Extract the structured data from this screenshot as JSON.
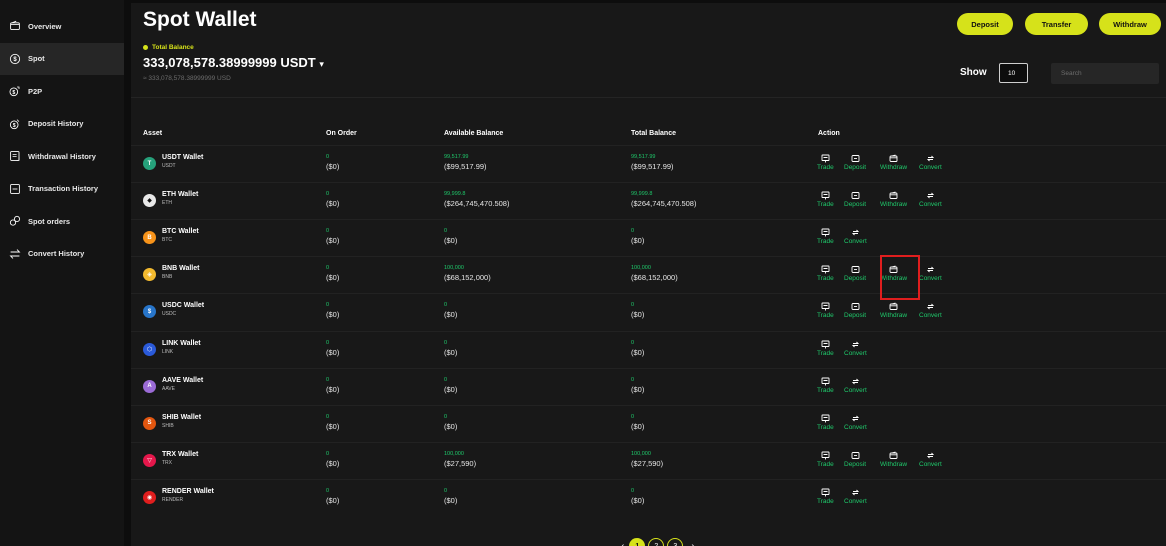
{
  "sidebar": {
    "items": [
      {
        "label": "Overview",
        "icon": "wallet-icon",
        "active": false
      },
      {
        "label": "Spot",
        "icon": "dollar-circle-icon",
        "active": true
      },
      {
        "label": "P2P",
        "icon": "p2p-icon",
        "active": false
      },
      {
        "label": "Deposit History",
        "icon": "deposit-history-icon",
        "active": false
      },
      {
        "label": "Withdrawal History",
        "icon": "withdrawal-history-icon",
        "active": false
      },
      {
        "label": "Transaction History",
        "icon": "transaction-history-icon",
        "active": false
      },
      {
        "label": "Spot orders",
        "icon": "spot-orders-icon",
        "active": false
      },
      {
        "label": "Convert History",
        "icon": "swap-arrows-icon",
        "active": false
      }
    ]
  },
  "header": {
    "title": "Spot Wallet",
    "total_balance_label": "Total Balance",
    "total_balance_value": "333,078,578.38999999 USDT",
    "total_balance_usd": "≈ 333,078,578.38999999 USD",
    "buttons": {
      "deposit": "Deposit",
      "transfer": "Transfer",
      "withdraw": "Withdraw"
    },
    "show_label": "Show",
    "show_value": "10",
    "search_placeholder": "Search"
  },
  "table": {
    "headers": {
      "asset": "Asset",
      "on_order": "On Order",
      "available": "Available Balance",
      "total": "Total Balance",
      "action": "Action"
    },
    "action_labels": {
      "trade": "Trade",
      "deposit": "Deposit",
      "withdraw": "Withdraw",
      "convert": "Convert"
    },
    "rows": [
      {
        "name": "USDT Wallet",
        "symbol": "USDT",
        "color": "#26a17b",
        "glyph": "T",
        "on_order": "0",
        "on_order_usd": "($0)",
        "available": "99,517.99",
        "available_usd": "($99,517.99)",
        "total": "99,517.99",
        "total_usd": "($99,517.99)",
        "actions": [
          "trade",
          "deposit",
          "withdraw",
          "convert"
        ]
      },
      {
        "name": "ETH Wallet",
        "symbol": "ETH",
        "color": "#e8e8e8",
        "glyph": "◆",
        "on_order": "0",
        "on_order_usd": "($0)",
        "available": "99,999.8",
        "available_usd": "($264,745,470.508)",
        "total": "99,999.8",
        "total_usd": "($264,745,470.508)",
        "actions": [
          "trade",
          "deposit",
          "withdraw",
          "convert"
        ]
      },
      {
        "name": "BTC Wallet",
        "symbol": "BTC",
        "color": "#f7931a",
        "glyph": "B",
        "on_order": "0",
        "on_order_usd": "($0)",
        "available": "0",
        "available_usd": "($0)",
        "total": "0",
        "total_usd": "($0)",
        "actions": [
          "trade",
          "convert"
        ]
      },
      {
        "name": "BNB Wallet",
        "symbol": "BNB",
        "color": "#f3ba2f",
        "glyph": "◈",
        "on_order": "0",
        "on_order_usd": "($0)",
        "available": "100,000",
        "available_usd": "($68,152,000)",
        "total": "100,000",
        "total_usd": "($68,152,000)",
        "actions": [
          "trade",
          "deposit",
          "withdraw",
          "convert"
        ]
      },
      {
        "name": "USDC Wallet",
        "symbol": "USDC",
        "color": "#2775ca",
        "glyph": "$",
        "on_order": "0",
        "on_order_usd": "($0)",
        "available": "0",
        "available_usd": "($0)",
        "total": "0",
        "total_usd": "($0)",
        "actions": [
          "trade",
          "deposit",
          "withdraw",
          "convert"
        ]
      },
      {
        "name": "LINK Wallet",
        "symbol": "LINK",
        "color": "#2a5ada",
        "glyph": "⬡",
        "on_order": "0",
        "on_order_usd": "($0)",
        "available": "0",
        "available_usd": "($0)",
        "total": "0",
        "total_usd": "($0)",
        "actions": [
          "trade",
          "convert"
        ]
      },
      {
        "name": "AAVE Wallet",
        "symbol": "AAVE",
        "color": "#9b6bd6",
        "glyph": "A",
        "on_order": "0",
        "on_order_usd": "($0)",
        "available": "0",
        "available_usd": "($0)",
        "total": "0",
        "total_usd": "($0)",
        "actions": [
          "trade",
          "convert"
        ]
      },
      {
        "name": "SHIB Wallet",
        "symbol": "SHIB",
        "color": "#e3560f",
        "glyph": "S",
        "on_order": "0",
        "on_order_usd": "($0)",
        "available": "0",
        "available_usd": "($0)",
        "total": "0",
        "total_usd": "($0)",
        "actions": [
          "trade",
          "convert"
        ]
      },
      {
        "name": "TRX Wallet",
        "symbol": "TRX",
        "color": "#e5174b",
        "glyph": "▽",
        "on_order": "0",
        "on_order_usd": "($0)",
        "available": "100,000",
        "available_usd": "($27,590)",
        "total": "100,000",
        "total_usd": "($27,590)",
        "actions": [
          "trade",
          "deposit",
          "withdraw",
          "convert"
        ]
      },
      {
        "name": "RENDER Wallet",
        "symbol": "RENDER",
        "color": "#e01e1e",
        "glyph": "◉",
        "on_order": "0",
        "on_order_usd": "($0)",
        "available": "0",
        "available_usd": "($0)",
        "total": "0",
        "total_usd": "($0)",
        "actions": [
          "trade",
          "convert"
        ]
      }
    ]
  },
  "pagination": {
    "prev": "‹",
    "next": "›",
    "pages": [
      "1",
      "2",
      "3"
    ],
    "current": "1"
  },
  "colors": {
    "accent": "#d6e21a",
    "green": "#1fc96b",
    "highlight": "#e01e1e"
  }
}
